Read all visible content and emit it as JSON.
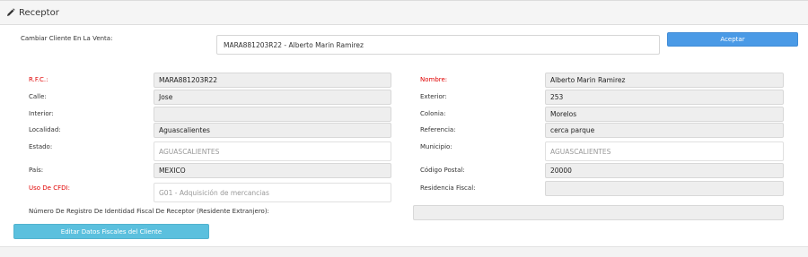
{
  "panel": {
    "title": "Receptor"
  },
  "change_client": {
    "label": "Cambiar Cliente En La Venta:",
    "value": "MARA881203R22 - Alberto Marin Ramirez",
    "button": "Aceptar"
  },
  "left": {
    "rfc": {
      "label": "R.F.C.:",
      "value": "MARA881203R22"
    },
    "calle": {
      "label": "Calle:",
      "value": "Jose"
    },
    "interior": {
      "label": "Interior:",
      "value": ""
    },
    "localidad": {
      "label": "Localidad:",
      "value": "Aguascalientes"
    },
    "estado": {
      "label": "Estado:",
      "value": "AGUASCALIENTES"
    },
    "pais": {
      "label": "País:",
      "value": "MEXICO"
    },
    "uso_cfdi": {
      "label": "Uso De CFDI:",
      "value": "G01 - Adquisición de mercancias"
    }
  },
  "right": {
    "nombre": {
      "label": "Nombre:",
      "value": "Alberto Marin Ramirez"
    },
    "exterior": {
      "label": "Exterior:",
      "value": "253"
    },
    "colonia": {
      "label": "Colonia:",
      "value": "Morelos"
    },
    "referencia": {
      "label": "Referencia:",
      "value": "cerca parque"
    },
    "municipio": {
      "label": "Municipio:",
      "value": "AGUASCALIENTES"
    },
    "cp": {
      "label": "Código Postal:",
      "value": "20000"
    },
    "residencia": {
      "label": "Residencia Fiscal:",
      "value": ""
    }
  },
  "registro": {
    "label": "Número De Registro De Identidad Fiscal De Receptor (Residente Extranjero):",
    "value": ""
  },
  "edit_button": "Editar Datos Fiscales del Cliente"
}
